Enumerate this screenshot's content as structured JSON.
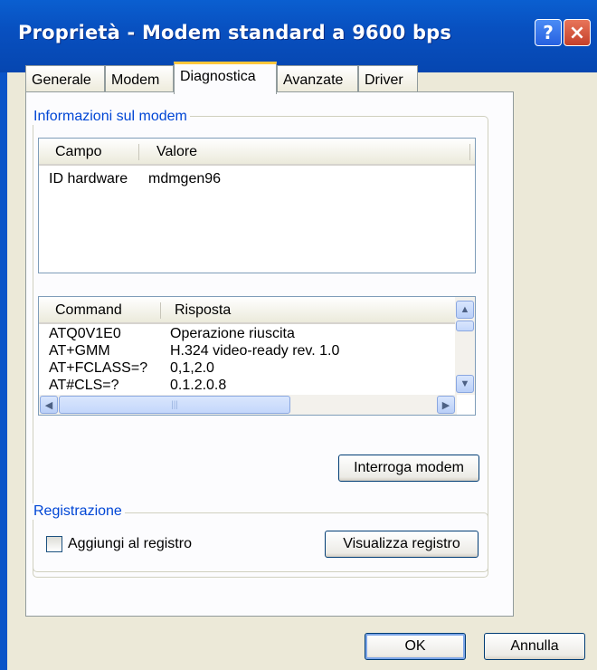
{
  "window": {
    "title": "Proprietà - Modem standard a 9600 bps",
    "help_glyph": "?",
    "close_glyph": "×"
  },
  "tabs": [
    {
      "label": "Generale"
    },
    {
      "label": "Modem"
    },
    {
      "label": "Diagnostica",
      "active": true
    },
    {
      "label": "Avanzate"
    },
    {
      "label": "Driver"
    }
  ],
  "modem_info": {
    "group_label": "Informazioni sul modem",
    "columns": [
      "Campo",
      "Valore"
    ],
    "rows": [
      {
        "field": "ID hardware",
        "value": "mdmgen96"
      }
    ]
  },
  "commands": {
    "columns": [
      "Command",
      "Risposta"
    ],
    "rows": [
      {
        "command": "ATQ0V1E0",
        "response": "Operazione riuscita"
      },
      {
        "command": "AT+GMM",
        "response": "H.324 video-ready rev. 1.0"
      },
      {
        "command": "AT+FCLASS=?",
        "response": "0,1,2.0"
      },
      {
        "command": "AT#CLS=?",
        "response": "0.1.2.0.8"
      }
    ],
    "query_button": "Interroga modem"
  },
  "logging": {
    "group_label": "Registrazione",
    "append_label": "Aggiungi al registro",
    "append_checked": false,
    "view_button": "Visualizza registro"
  },
  "footer": {
    "ok_button": "OK",
    "cancel_button": "Annulla"
  }
}
